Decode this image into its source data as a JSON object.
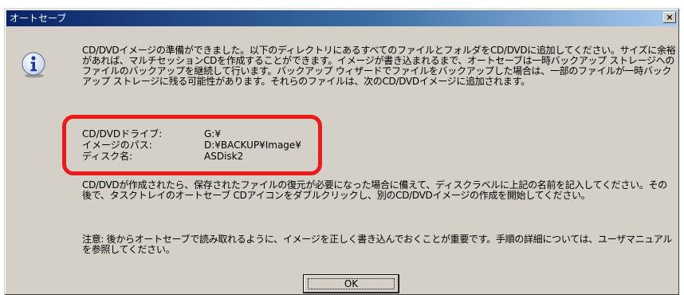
{
  "window": {
    "title": "オートセーブ",
    "close_label": "×"
  },
  "message": {
    "paragraph1": "CD/DVDイメージの準備ができました。以下のディレクトリにあるすべてのファイルとフォルダをCD/DVDに追加してください。サイズに余裕があれば、マルチセッションCDを作成することができます。イメージが書き込まれるまで、オートセーブは一時バックアップ ストレージへのファイルのバックアップを継続して行います。バックアップ ウィザードでファイルをバックアップした場合は、一部のファイルが一時バックアップ ストレージに残る可能性があります。それらのファイルは、次のCD/DVDイメージに追加されます。",
    "details": [
      {
        "label": "CD/DVDドライブ:",
        "value": "G:¥"
      },
      {
        "label": "イメージのパス:",
        "value": "D:¥BACKUP¥Image¥"
      },
      {
        "label": "ディスク名:",
        "value": "ASDisk2"
      }
    ],
    "paragraph2": "CD/DVDが作成されたら、保存されたファイルの復元が必要になった場合に備えて、ディスクラベルに上記の名前を記入してください。その後で、タスクトレイのオートセーブ CDアイコンをダブルクリックし、別のCD/DVDイメージの作成を開始してください。",
    "paragraph3": "注意: 後からオートセーブで読み取れるように、イメージを正しく書き込んでおくことが重要です。手順の詳細については、ユーザマニュアルを参照してください。"
  },
  "buttons": {
    "ok_label": "OK"
  },
  "colors": {
    "titlebar_start": "#0a246a",
    "titlebar_end": "#a6caf0",
    "dialog_face": "#d4d0c8",
    "highlight": "#ee1a1a"
  }
}
